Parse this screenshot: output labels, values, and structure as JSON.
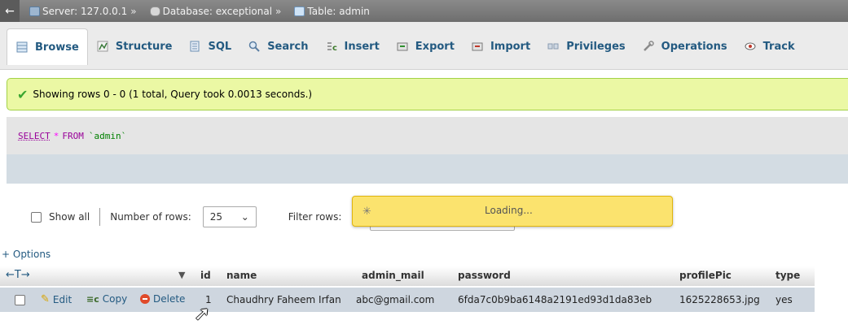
{
  "breadcrumb": {
    "back_label": "←",
    "server": "Server: 127.0.0.1",
    "database": "Database: exceptional",
    "table": "Table: admin",
    "separator": "»"
  },
  "tabs": [
    {
      "label": "Browse",
      "icon": "browse-icon",
      "active": true
    },
    {
      "label": "Structure",
      "icon": "structure-icon"
    },
    {
      "label": "SQL",
      "icon": "sql-icon"
    },
    {
      "label": "Search",
      "icon": "search-icon"
    },
    {
      "label": "Insert",
      "icon": "insert-icon"
    },
    {
      "label": "Export",
      "icon": "export-icon"
    },
    {
      "label": "Import",
      "icon": "import-icon"
    },
    {
      "label": "Privileges",
      "icon": "privileges-icon"
    },
    {
      "label": "Operations",
      "icon": "operations-icon"
    },
    {
      "label": "Track",
      "icon": "tracking-icon"
    }
  ],
  "message": "Showing rows 0 - 0 (1 total, Query took 0.0013 seconds.)",
  "sql": {
    "select": "SELECT",
    "star": "*",
    "from": "FROM",
    "table": "`admin`"
  },
  "nav": {
    "show_all": "Show all",
    "rows_label": "Number of rows:",
    "rows_value": "25",
    "filter_label": "Filter rows:"
  },
  "loading": "Loading...",
  "options_label": "+ Options",
  "table": {
    "headers": [
      "id",
      "name",
      "admin_mail",
      "password",
      "profilePic",
      "type"
    ],
    "actions": {
      "edit": "Edit",
      "copy": "Copy",
      "delete": "Delete"
    },
    "rows": [
      [
        "1",
        "Chaudhry Faheem Irfan",
        "abc@gmail.com",
        "6fda7c0b9ba6148a2191ed93d1da83eb",
        "1625228653.jpg",
        "yes"
      ]
    ]
  },
  "colors": {
    "success_bg": "#ebf8a4",
    "loading_bg": "#fbe36e",
    "link": "#235a81",
    "row_bg": "#ced6df"
  }
}
